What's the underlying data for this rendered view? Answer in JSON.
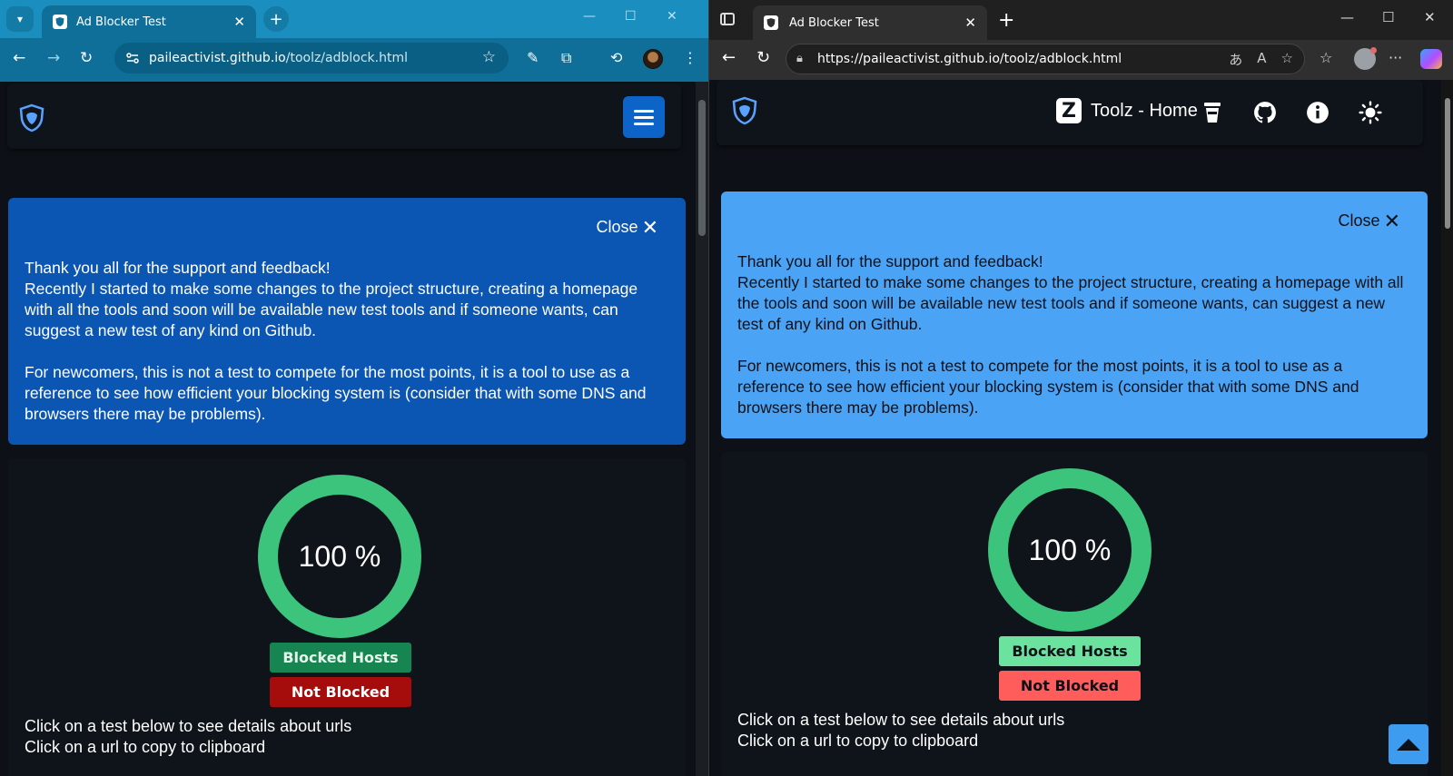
{
  "left_browser": {
    "tab_title": "Ad Blocker Test",
    "url_domain": "paileactivist.github.io",
    "url_path": "/toolz/adblock.html",
    "accent": "#1a8fbf"
  },
  "right_browser": {
    "tab_title": "Ad Blocker Test",
    "url": "https://paileactivist.github.io/toolz/adblock.html"
  },
  "site": {
    "home_link": "Toolz - Home",
    "notice": {
      "close_label": "Close",
      "para1_line1": "Thank you all for the support and feedback!",
      "para1_line2": "Recently I started to make some changes to the project structure, creating a homepage with all the tools and soon will be available new test tools and if someone wants, can suggest a new test of any kind on Github.",
      "para2": "For newcomers, this is not a test to compete for the most points, it is a tool to use as a reference to see how efficient your blocking system is (consider that with some DNS and browsers there may be problems)."
    },
    "score": {
      "value": 100,
      "label": "100 %",
      "ring_color": "#3cc47c"
    },
    "legend": {
      "blocked": "Blocked Hosts",
      "not_blocked": "Not Blocked"
    },
    "hints": {
      "line1": "Click on a test below to see details about urls",
      "line2": "Click on a url to copy to clipboard"
    },
    "colors": {
      "left_notice": "#0c56b3",
      "right_notice": "#4aa3f5",
      "left_blocked": "#168551",
      "left_not_blocked": "#a50c0c",
      "right_blocked": "#6be39f",
      "right_not_blocked": "#ff5c5c"
    }
  }
}
